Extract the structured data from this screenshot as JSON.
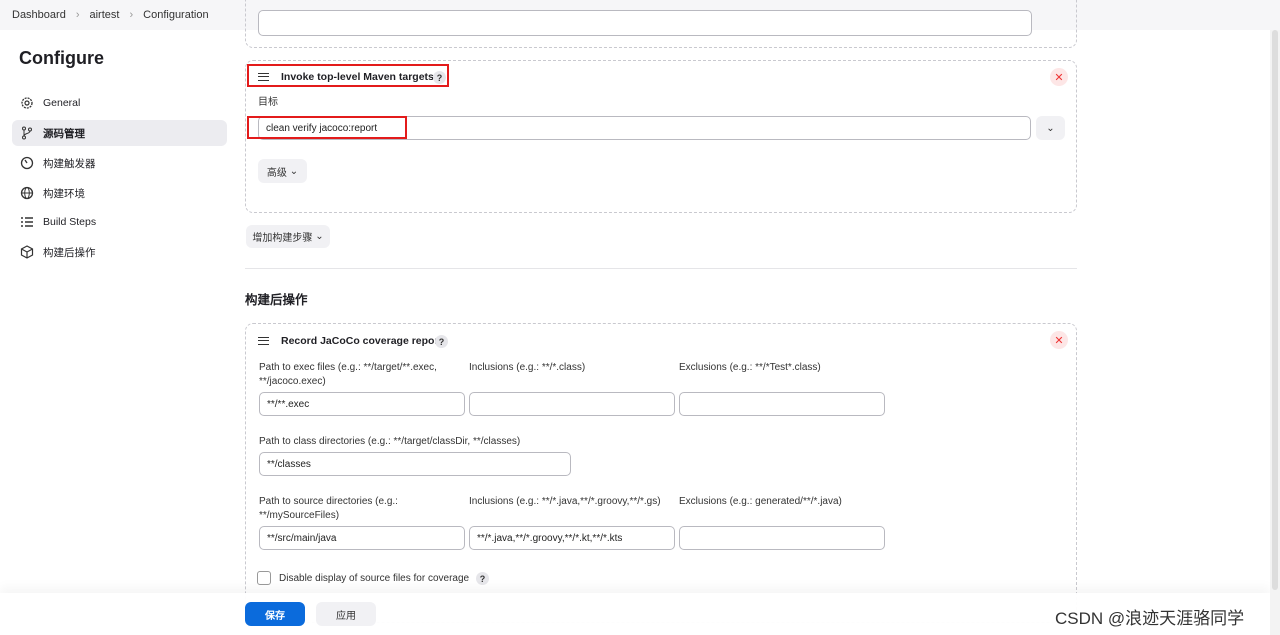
{
  "breadcrumb": [
    "Dashboard",
    "airtest",
    "Configuration"
  ],
  "page_title": "Configure",
  "sidebar": {
    "items": [
      {
        "label": "General",
        "icon": "gear-icon"
      },
      {
        "label": "源码管理",
        "icon": "branch-icon",
        "active": true
      },
      {
        "label": "构建触发器",
        "icon": "timer-icon"
      },
      {
        "label": "构建环境",
        "icon": "globe-icon"
      },
      {
        "label": "Build Steps",
        "icon": "list-icon"
      },
      {
        "label": "构建后操作",
        "icon": "package-icon"
      }
    ]
  },
  "maven": {
    "title": "Invoke top-level Maven targets",
    "help": "?",
    "goal_label": "目标",
    "goal_value": "clean verify jacoco:report",
    "advanced": "高级"
  },
  "add_step": "增加构建步骤",
  "post_heading": "构建后操作",
  "jacoco": {
    "title": "Record JaCoCo coverage report",
    "help": "?",
    "exec_label": "Path to exec files (e.g.: **/target/**.exec, **/jacoco.exec)",
    "exec_value": "**/**.exec",
    "incl_label": "Inclusions (e.g.: **/*.class)",
    "incl_value": "",
    "excl_label": "Exclusions (e.g.: **/*Test*.class)",
    "excl_value": "",
    "class_label": "Path to class directories (e.g.: **/target/classDir, **/classes)",
    "class_value": "**/classes",
    "src_label": "Path to source directories (e.g.: **/mySourceFiles)",
    "src_value": "**/src/main/java",
    "src_incl_label": "Inclusions (e.g.: **/*.java,**/*.groovy,**/*.gs)",
    "src_incl_value": "**/*.java,**/*.groovy,**/*.kt,**/*.kts",
    "src_excl_label": "Exclusions (e.g.: generated/**/*.java)",
    "src_excl_value": "",
    "disable_label": "Disable display of source files for coverage",
    "disable_checked": false
  },
  "footer": {
    "save": "保存",
    "apply": "应用"
  },
  "watermark": "CSDN @浪迹天涯骆同学",
  "colors": {
    "primary": "#0b6bdc",
    "highlight": "#e31b1b"
  }
}
